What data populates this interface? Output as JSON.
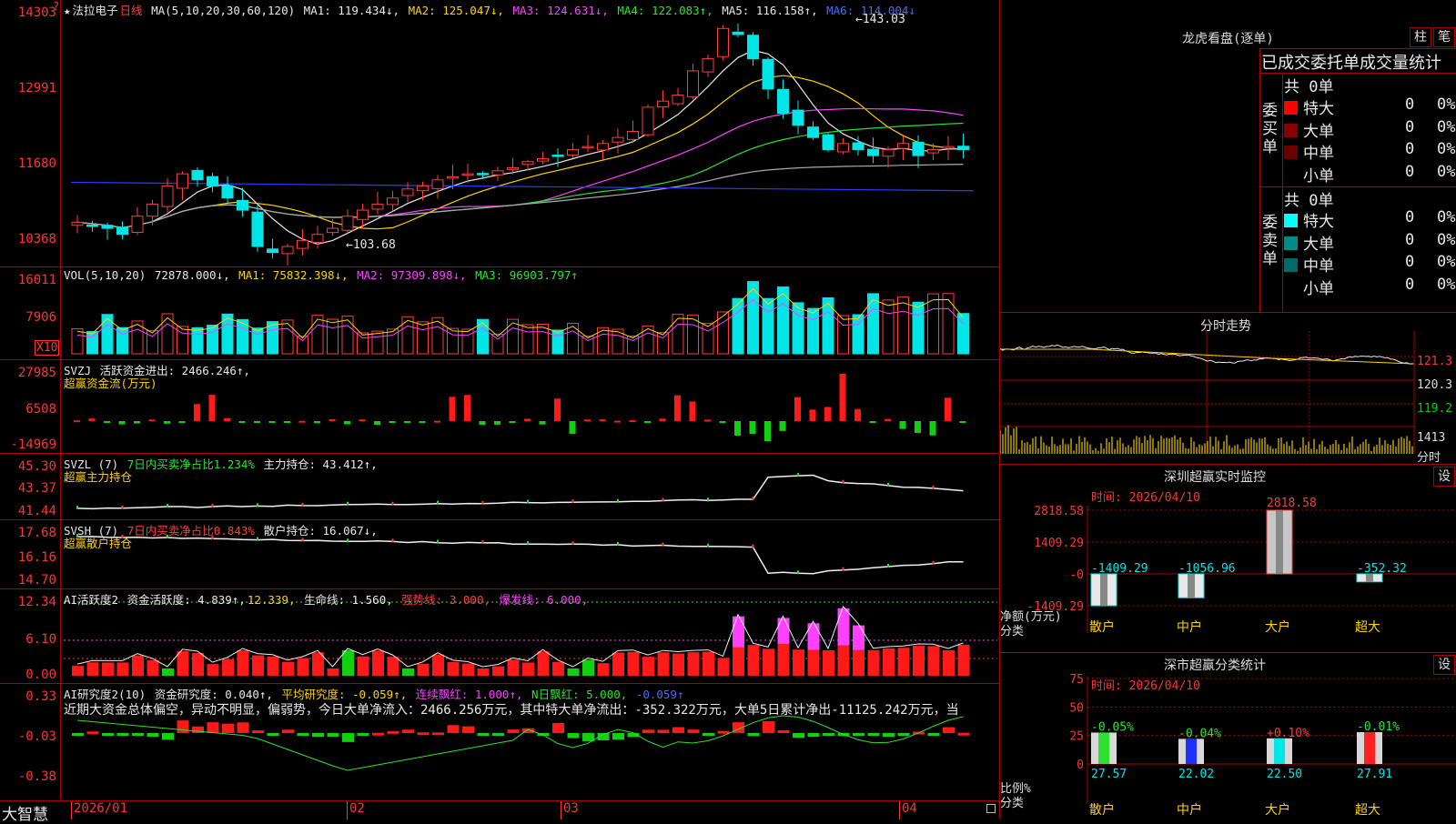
{
  "app": {
    "brand": "大智慧"
  },
  "main": {
    "star": "★",
    "stock_name": "法拉电子",
    "period": "日线",
    "ma_def": "MA(5,10,20,30,60,120)",
    "ma1": "MA1: 119.434↓,",
    "ma2": "MA2: 125.047↓,",
    "ma3": "MA3: 124.631↓,",
    "ma4": "MA4: 122.083↑,",
    "ma5": "MA5: 116.158↑,",
    "ma6": "MA6: 114.004↓",
    "hi_label": "143.03",
    "lo_label": "103.68",
    "ticks": [
      "14303",
      "12991",
      "11680",
      "10368"
    ]
  },
  "vol": {
    "def": "VOL(5,10,20)",
    "v": "72878.000↓,",
    "ma1": "MA1: 75832.398↓,",
    "ma2": "MA2: 97309.898↓,",
    "ma3": "MA3: 96903.797↑",
    "ticks": [
      "16011",
      "7906"
    ],
    "unit": "X10"
  },
  "svzj": {
    "def": "SVZJ",
    "text": " 活跃资金进出: 2466.246↑,",
    "sub": "超赢资金流(万元)",
    "ticks": [
      "27985",
      "6508",
      "-14969"
    ]
  },
  "svzl": {
    "def": "SVZL (7)",
    "text1": " 7日内买卖净占比1.234%",
    "text2": " 主力持仓: 43.412↑,",
    "sub": "超赢主力持仓",
    "ticks": [
      "45.30",
      "43.37",
      "41.44"
    ]
  },
  "svsh": {
    "def": "SVSH (7)",
    "text1": " 7日内买卖净占比0.843%",
    "text2": " 散户持仓: 16.067↓,",
    "sub": "超赢散户持仓",
    "ticks": [
      "17.68",
      "16.16",
      "14.70"
    ]
  },
  "ai2": {
    "def": "AI活跃度2",
    "t1": " 资金活跃度: 4.839↑,",
    "t2": "12.339,",
    "t3": " 生命线: 1.560,",
    "t4": " 强势线: 3.000,",
    "t5": " 爆发线: 6.000,",
    "ticks": [
      "12.34",
      "6.10",
      "0.00"
    ]
  },
  "ai_res": {
    "def": "AI研究度2(10)",
    "t1": " 资金研究度: 0.040↑,",
    "t2": " 平均研究度: -0.059↑,",
    "t3": " 连续飘红: 1.000↑,",
    "t4": " N日飘红: 5.000,",
    "t5": " -0.059↑",
    "comment": "近期大资金总体偏空，异动不明显，偏弱势，今日大单净流入：2466.256万元，其中特大单净流出：-352.322万元，大单5日累计净出-11125.242万元，当",
    "ticks": [
      "0.33",
      "-0.03",
      "-0.38"
    ]
  },
  "dates": [
    "2026/01",
    "02",
    "03",
    "04"
  ],
  "right": {
    "lh_title": "龙虎看盘(逐单)",
    "btn1": "柱",
    "btn2": "笔",
    "tabs": "已成交委托单成交量统计",
    "buy_label": [
      "委",
      "买",
      "单"
    ],
    "sell_label": [
      "委",
      "卖",
      "单"
    ],
    "buy_total": "共 0单",
    "sell_total": "共 0单",
    "rows": [
      {
        "name": "特大",
        "n": "0",
        "p": "0%"
      },
      {
        "name": "大单",
        "n": "0",
        "p": "0%"
      },
      {
        "name": "中单",
        "n": "0",
        "p": "0%"
      },
      {
        "name": "小单",
        "n": "0",
        "p": "0%"
      }
    ],
    "buy_colors": [
      "#ff0000",
      "#8a0000",
      "#6a0000",
      "#000000"
    ],
    "sell_colors": [
      "#00ffff",
      "#008a8a",
      "#006a6a",
      "#000000"
    ],
    "fs_title": "分时走势",
    "fs_ticks": [
      "121.3",
      "120.3",
      "119.2",
      "1413"
    ],
    "fs_unit": "分时",
    "sz_title": "深圳超赢实时监控",
    "sz_btn": "设",
    "sz_time": "时间: 2026/04/10",
    "sz_ticks": [
      "2818.58",
      "1409.29",
      "-0",
      "-1409.29"
    ],
    "sz_ylabel": "净额(万元)",
    "sz_xlabel": "分类",
    "sz_values": [
      "-1409.29",
      "-1056.96",
      "2818.58",
      "-352.32"
    ],
    "categories": [
      "散户",
      "中户",
      "大户",
      "超大"
    ],
    "sc_title": "深市超赢分类统计",
    "sc_btn": "设",
    "sc_time": "时间: 2026/04/10",
    "sc_ticks": [
      "75",
      "50",
      "25",
      "0"
    ],
    "sc_ylabel": "比例%",
    "sc_xlabel": "分类",
    "sc_chg": [
      "-0.05%",
      "-0.04%",
      "+0.10%",
      "-0.01%"
    ],
    "sc_vals": [
      "27.57",
      "22.02",
      "22.50",
      "27.91"
    ]
  },
  "chart_data": {
    "type": "candlestick",
    "price_ylim": [
      10368,
      14303
    ],
    "dates": [
      "2026/01",
      "02",
      "03",
      "04"
    ],
    "shenzhen_net": {
      "categories": [
        "散户",
        "中户",
        "大户",
        "超大"
      ],
      "values": [
        -1409.29,
        -1056.96,
        2818.58,
        -352.32
      ],
      "ylim": [
        -1409.29,
        2818.58
      ]
    },
    "shenzhen_ratio": {
      "categories": [
        "散户",
        "中户",
        "大户",
        "超大"
      ],
      "values": [
        27.57,
        22.02,
        22.5,
        27.91
      ],
      "change": [
        "-0.05%",
        "-0.04%",
        "+0.10%",
        "-0.01%"
      ],
      "ylim": [
        0,
        75
      ]
    }
  }
}
